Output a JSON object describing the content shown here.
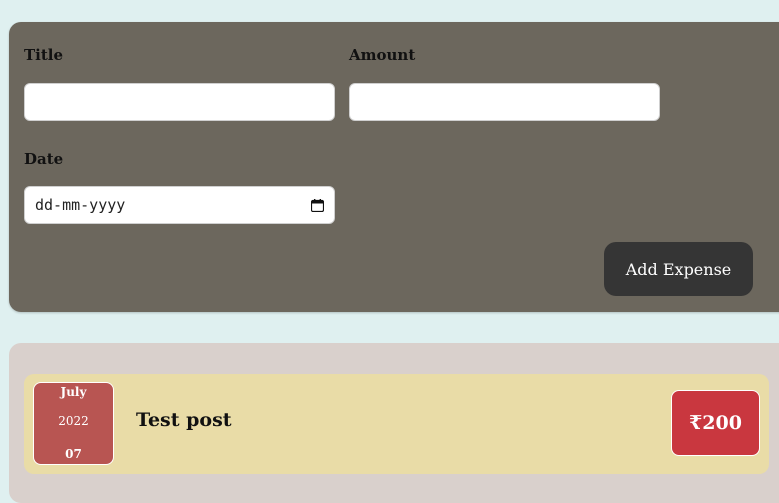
{
  "form": {
    "title_label": "Title",
    "title_value": "",
    "amount_label": "Amount",
    "amount_value": "",
    "date_label": "Date",
    "date_placeholder": "dd-mm-yyyy",
    "date_icon": "calendar-icon",
    "submit_label": "Add Expense"
  },
  "expenses": [
    {
      "month": "July",
      "year": "2022",
      "day": "07",
      "title": "Test post",
      "amount": "₹200"
    }
  ],
  "colors": {
    "page_background": "#dff0f0",
    "form_panel": "#6c675d",
    "submit_button": "#353535",
    "list_panel": "#d9d0cc",
    "expense_item": "#e9dca7",
    "date_tile": "#b85552",
    "amount_badge": "#c9373f"
  }
}
